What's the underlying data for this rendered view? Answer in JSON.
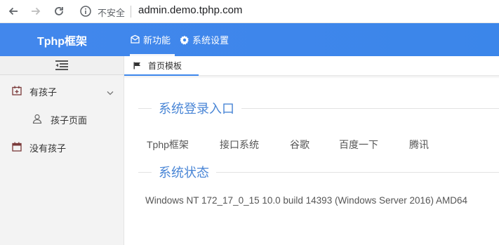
{
  "browser": {
    "insecure_label": "不安全",
    "url": "admin.demo.tphp.com"
  },
  "header": {
    "brand": "Tphp框架",
    "nav": [
      {
        "label": "新功能",
        "icon": "message-icon",
        "active": true
      },
      {
        "label": "系统设置",
        "icon": "gear-icon",
        "active": false
      }
    ]
  },
  "sidebar": {
    "items": [
      {
        "label": "有孩子",
        "icon": "calendar-plus-icon",
        "expanded": true
      },
      {
        "label": "孩子页面",
        "icon": "user-icon"
      },
      {
        "label": "没有孩子",
        "icon": "calendar-icon"
      }
    ]
  },
  "tabs": [
    {
      "label": "首页模板",
      "icon": "flag-icon",
      "active": true
    }
  ],
  "content": {
    "login_title": "系统登录入口",
    "links": [
      "Tphp框架",
      "接口系统",
      "谷歌",
      "百度一下",
      "腾讯"
    ],
    "status_title": "系统状态",
    "status_text": "Windows NT 172_17_0_15 10.0 build 14393 (Windows Server 2016) AMD64"
  },
  "colors": {
    "header_bg": "#3d87ec",
    "section_title": "#4a86d6",
    "sidebar_bg": "#f3f3f3"
  }
}
